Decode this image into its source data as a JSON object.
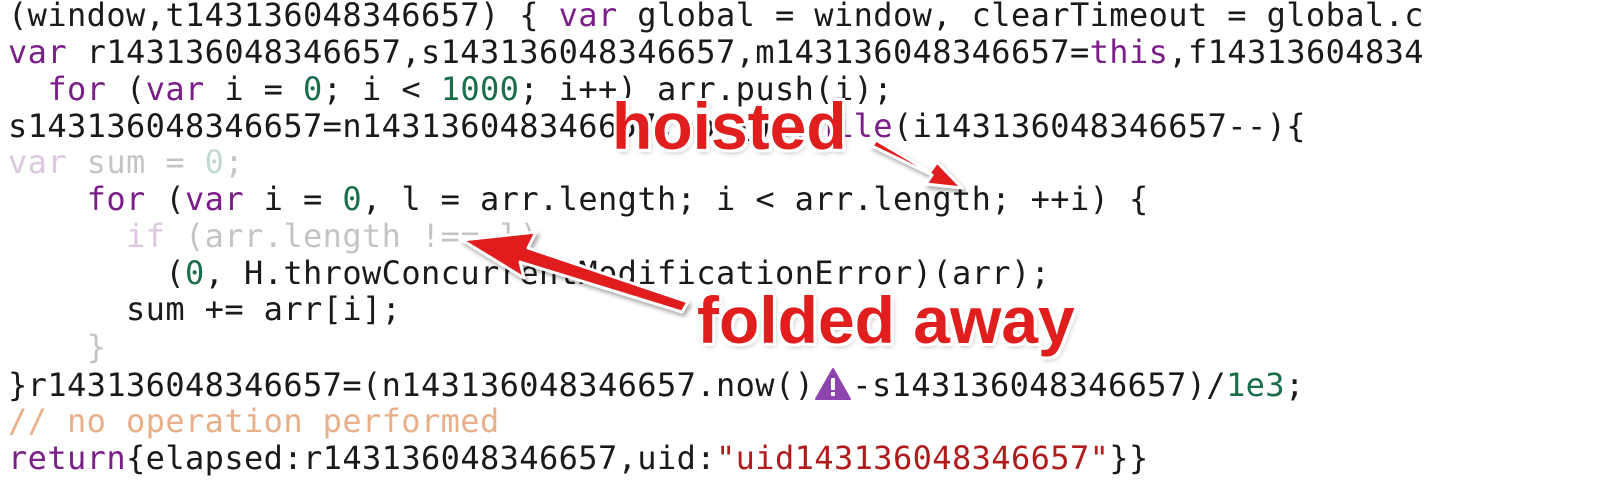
{
  "colors": {
    "keyword": "#7a1f87",
    "number": "#1a6e4a",
    "string": "#b01c1c",
    "comment": "#e8b08a",
    "annotation": "#e01e1e",
    "warning_icon": "#8e44ad"
  },
  "code": {
    "l1_a": "(window,t143136048346657) { ",
    "l1_kw": "var",
    "l1_b": " global = window, clearTimeout = global.c",
    "l2_kw": "var",
    "l2_a": " r143136048346657,s143136048346657,m143136048346657=",
    "l2_this": "this",
    "l2_b": ",f14313604834",
    "l3_indent": "  ",
    "l3_for": "for",
    "l3_a": " (",
    "l3_var": "var",
    "l3_b": " i = ",
    "l3_n0": "0",
    "l3_c": "; i < ",
    "l3_n1000": "1000",
    "l3_d": "; i++) arr.push(i);",
    "l4_a": "s143136048346657=n143136048346657.now()",
    "l4_semi": ";",
    "l4_while": "while",
    "l4_b": "(i143136048346657--){",
    "l5_var": "var",
    "l5_a": " sum = ",
    "l5_n0": "0",
    "l5_b": ";",
    "l6_indent": "    ",
    "l6_for": "for",
    "l6_a": " (",
    "l6_var": "var",
    "l6_b": " i = ",
    "l6_n0": "0",
    "l6_c": ", l = arr.length; i < arr.length; ++i) {",
    "l7_indent": "      ",
    "l7_if": "if",
    "l7_a": " (arr.length !== l)",
    "l8_indent": "        (",
    "l8_n0": "0",
    "l8_a": ", H.throwConcurrentModificationError)(arr);",
    "l9_a": "      sum += arr[i];",
    "l10_a": "    }",
    "l11_a": "}r143136048346657=(n143136048346657.now()",
    "l11_b": "-s143136048346657)/",
    "l11_num": "1e3",
    "l11_c": ";",
    "l12_comment": "// no operation performed",
    "l13_return": "return",
    "l13_a": "{elapsed:r143136048346657,uid:",
    "l13_str": "\"uid143136048346657\"",
    "l13_b": "}}"
  },
  "annotations": {
    "hoisted": "hoisted",
    "folded_away": "folded away"
  },
  "icons": {
    "warning": "warning-triangle-icon"
  }
}
